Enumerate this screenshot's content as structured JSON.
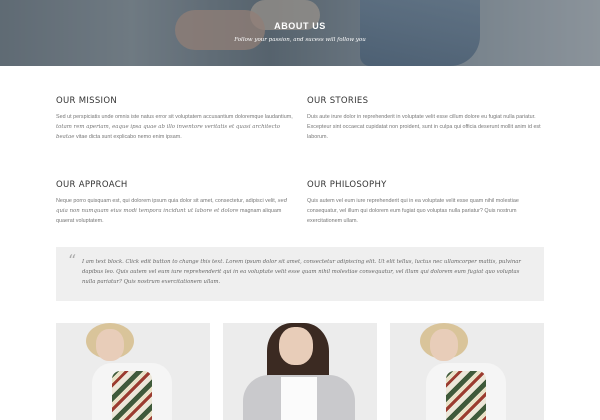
{
  "hero": {
    "title": "ABOUT US",
    "subtitle": "Follow your passion, and sucess will follow you"
  },
  "sections": {
    "mission": {
      "title": "OUR MISSION",
      "text_plain": "Sed ut perspiciatis unde omnis iste natus error sit voluptatem accusantium doloremque laudantium,",
      "text_italic": "totam rem aperiam, eaque ipsa quae ab illo inventore veritatis et quasi architecto beatae",
      "text_tail": "vitae dicta sunt explicabo nemo enim ipsam."
    },
    "stories": {
      "title": "OUR STORIES",
      "text": "Duis aute irure dolor in reprehenderit in voluptate velit esse cillum dolore eu fugiat nulla pariatur. Excepteur sint occaecat cupidatat non proident, sunt in culpa qui officia deserunt mollit anim id est laborum."
    },
    "approach": {
      "title": "OUR APPROACH",
      "text_plain": "Neque porro quisquam est, qui dolorem ipsum quia dolor sit amet, consectetur, adipisci velit,",
      "text_italic": "sed quia non numquam eius modi tempora incidunt ut labore et dolore",
      "text_tail": "magnam aliquam quaerat voluptatem."
    },
    "philosophy": {
      "title": "OUR PHILOSOPHY",
      "text": "Quis autem vel eum iure reprehenderit qui in ea voluptate velit esse quam nihil molestiae consequatur, vel illum qui dolorem eum fugiat quo voluptas nulla pariatur? Quis nostrum exercitationem ullam."
    }
  },
  "quote": {
    "mark": "“",
    "text": "I am text block. Click edit button to change this text. Lorem ipsum dolor sit amet, consectetur adipiscing elit. Ut elit tellus, luctus nec ullamcorper mattis, pulvinar dapibus leo. Quis autem vel eum iure reprehenderit qui in ea voluptate velit esse quam nihil molestiae consequatur, vel illum qui dolorem eum fugiat quo voluptas nulla pariatur? Quis nostrum exercitationem ullam."
  },
  "colors": {
    "heading": "#333333",
    "body_text": "#777777",
    "quote_bg": "#efefef"
  }
}
